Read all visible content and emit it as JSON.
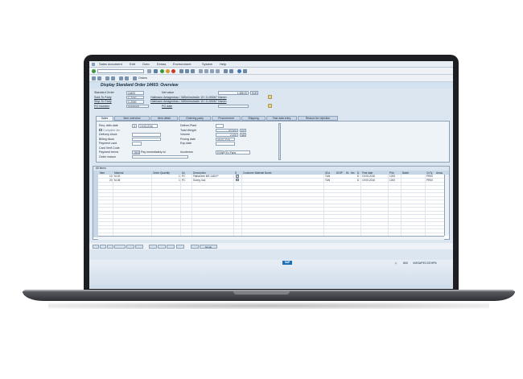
{
  "menu": [
    "Sales document",
    "Edit",
    "Goto",
    "Extras",
    "Environment",
    "System",
    "Help"
  ],
  "toolbar": {
    "orders_label": "Orders"
  },
  "title": "Display Standard Order 14403: Overview",
  "header": {
    "standard_order_label": "Standard Order",
    "standard_order_value": "14403",
    "net_value_label": "Net value",
    "net_value": "1.485,00",
    "currency": "EUR",
    "sold_to_label": "Sold-To Party",
    "sold_to_id": "C-2000",
    "sold_to_name": "Hallmann Anlagenbau / Wilhelmstraße 19 / D-59067 Hamm",
    "ship_to_label": "Ship-To Party",
    "ship_to_id": "C-2000",
    "ship_to_name": "Hallmann Anlagenbau / Wilhelmstraße 19 / D-59067 Hamm",
    "po_number_label": "PO Number",
    "po_number_value": "50488400",
    "po_date_label": "PO date"
  },
  "tabs": [
    "Sales",
    "Item overview",
    "Item detail",
    "Ordering party",
    "Procurement",
    "Shipping",
    "Fast data entry",
    "Reason for rejection"
  ],
  "sales": {
    "req_deliv_label": "Req. deliv.date",
    "req_deliv_prefix": "D",
    "req_deliv_value": "19.05.2016",
    "complete_dlv_label": "Complete dlv.",
    "delivery_block_label": "Delivery block",
    "billing_block_label": "Billing block",
    "payment_card_label": "Payment card",
    "card_verif_label": "Card Verif.Code",
    "payment_terms_label": "Payment terms",
    "payment_terms_code": "ZB01",
    "payment_terms_text": "Pay immediately w/",
    "incoterms_label": "Incoterms",
    "incoterms_code": "EXW",
    "incoterms_text": "Ex Parts",
    "order_reason_label": "Order reason",
    "deliv_plant_label": "Deliver.Plant",
    "total_weight_label": "Total Weight",
    "total_weight_value": "82,500",
    "total_weight_unit": "KG",
    "volume_label": "Volume",
    "volume_value": "2,100",
    "volume_unit": "M3",
    "pricing_date_label": "Pricing date",
    "pricing_date_value": "09.05.2016",
    "exp_date_label": "Exp.date"
  },
  "items": {
    "title": "All items",
    "columns": [
      "Item",
      "Material",
      "Order Quantity",
      "Un",
      "Description",
      "S",
      "Customer Material Numb",
      "ItCa",
      "DGIP",
      "HL",
      "Itm",
      "D",
      "First date",
      "Plnt",
      "Batch",
      "CnTy",
      "Amou"
    ],
    "rows": [
      {
        "item": "10",
        "material": "M-02",
        "qty": "1",
        "unit": "PC",
        "description": "Flatscreen MS 1460 P",
        "itca": "TAN",
        "d": "D",
        "first_date": "19.05.2016",
        "plant": "1200",
        "cnty": "PR00"
      },
      {
        "item": "20",
        "material": "M-06",
        "qty": "1",
        "unit": "PC",
        "description": "Sunny Xa1",
        "itca": "TAN",
        "d": "D",
        "first_date": "19.05.2016",
        "plant": "1200",
        "cnty": "PR00"
      }
    ]
  },
  "bottom": {
    "group_label": "Group"
  },
  "status": {
    "sap": "SAP",
    "client": "800",
    "system": "VMSAPECCEHP6"
  },
  "colors": {
    "accent": "#1f6fb6",
    "screen_bg": "#dce6f0",
    "bezel": "#1e1f22"
  }
}
